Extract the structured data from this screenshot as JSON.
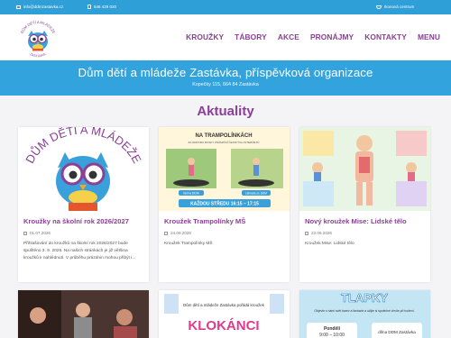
{
  "topbar": {
    "email": "info@ddmzastavka.cz",
    "phone": "546 429 020",
    "accessibility": "Ikonová centrum"
  },
  "header": {
    "logo_text_top": "DŮM DĚTÍ A MLÁDEŽE",
    "logo_text_bottom": "ZASTÁVKA",
    "nav": [
      "KROUŽKY",
      "TÁBORY",
      "AKCE",
      "PRONÁJMY",
      "KONTAKTY",
      "MENU"
    ]
  },
  "hero": {
    "title": "Dům dětí a mládeže Zastávka, příspěvková organizace",
    "address": "Kopečky 115, 664 84 Zastávka"
  },
  "section": {
    "title": "Aktuality"
  },
  "cards": [
    {
      "title": "Kroužky na školní rok 2026/2027",
      "date": "01.07.2026",
      "text": "Přihlašování do kroužků na školní rok 2026/2027 bude spuštěno 3. 9. 2026. Na našich stránkách je již většina kroužků k nahlédnutí. V průběhu prázdnin mohou přibýt i..."
    },
    {
      "title": "Kroužek Trampolínky MŠ",
      "date": "24.06.2026",
      "text": "Kroužek Trampolínky MŠ",
      "poster_title": "NA TRAMPOLÍNKÁCH",
      "poster_sub": "ZA ODPORU RUSKY ZNÁMIČNÍ ČEJSKÝCH INTERNETŮ",
      "poster_left": "farma DDM",
      "poster_right": "zahrada ze DDM",
      "poster_time": "KAŽDOU STŘEDU 16:15 – 17:15"
    },
    {
      "title": "Nový kroužek Mise: Lidské tělo",
      "date": "23.06.2026",
      "text": "Kroužek Mise: Lidské tělo"
    }
  ],
  "bottom_cards": [
    {
      "label": ""
    },
    {
      "line1": "Dům dětí a mládeže Zastávka pořádá kroužek",
      "big": "KLOKÁNCI"
    },
    {
      "big": "TLAPKY",
      "sub": "Objevte s námi svět barev a fantazie a užijte si společné chvíle při tvoření.",
      "day": "Pondělí",
      "time": "9:00 – 10:00",
      "place": "dílna DDM Zastávka"
    }
  ],
  "colors": {
    "primary": "#2f9fd8",
    "accent": "#8b3f95"
  }
}
